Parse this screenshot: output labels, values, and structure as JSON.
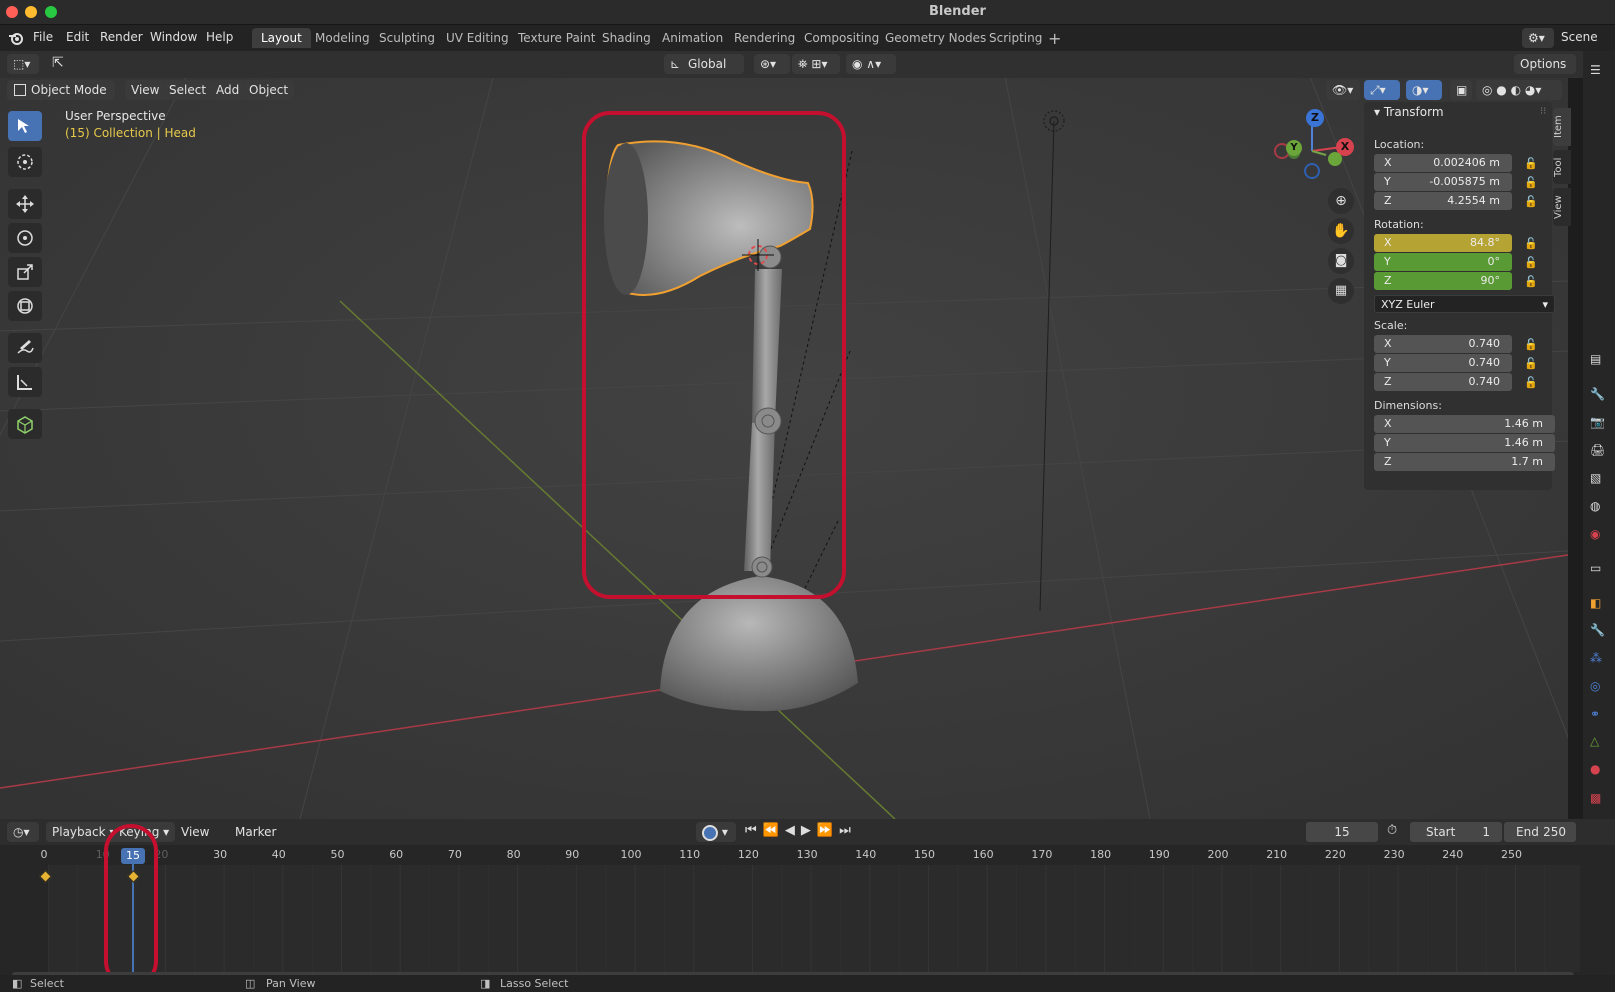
{
  "window": {
    "title": "Blender"
  },
  "menu": [
    "File",
    "Edit",
    "Render",
    "Window",
    "Help"
  ],
  "workspaces": [
    "Layout",
    "Modeling",
    "Sculpting",
    "UV Editing",
    "Texture Paint",
    "Shading",
    "Animation",
    "Rendering",
    "Compositing",
    "Geometry Nodes",
    "Scripting"
  ],
  "active_workspace": "Layout",
  "scene": "Scene",
  "header": {
    "orientation": "Global",
    "options": "Options",
    "mode": "Object Mode",
    "view_menu": [
      "View",
      "Select",
      "Add",
      "Object"
    ]
  },
  "viewport": {
    "perspective": "User Perspective",
    "collection": "(15) Collection | Head"
  },
  "gizmo": {
    "z": "Z",
    "y": "Y",
    "x": "X"
  },
  "npanel": {
    "title": "Transform",
    "location_label": "Location:",
    "location": [
      {
        "axis": "X",
        "value": "0.002406 m"
      },
      {
        "axis": "Y",
        "value": "-0.005875 m"
      },
      {
        "axis": "Z",
        "value": "4.2554 m"
      }
    ],
    "rotation_label": "Rotation:",
    "rotation": [
      {
        "axis": "X",
        "value": "84.8°"
      },
      {
        "axis": "Y",
        "value": "0°"
      },
      {
        "axis": "Z",
        "value": "90°"
      }
    ],
    "rotation_mode": "XYZ Euler",
    "scale_label": "Scale:",
    "scale": [
      {
        "axis": "X",
        "value": "0.740"
      },
      {
        "axis": "Y",
        "value": "0.740"
      },
      {
        "axis": "Z",
        "value": "0.740"
      }
    ],
    "dimensions_label": "Dimensions:",
    "dimensions": [
      {
        "axis": "X",
        "value": "1.46 m"
      },
      {
        "axis": "Y",
        "value": "1.46 m"
      },
      {
        "axis": "Z",
        "value": "1.7 m"
      }
    ],
    "tabs": [
      "Item",
      "Tool",
      "View"
    ]
  },
  "timeline": {
    "menus": [
      "Playback",
      "Keying",
      "View",
      "Marker"
    ],
    "current_frame": "15",
    "start_label": "Start",
    "start": "1",
    "end_label": "End",
    "end": "250",
    "ruler": [
      "0",
      "10",
      "20",
      "30",
      "40",
      "50",
      "60",
      "70",
      "80",
      "90",
      "100",
      "110",
      "120",
      "130",
      "140",
      "150",
      "160",
      "170",
      "180",
      "190",
      "200",
      "210",
      "220",
      "230",
      "240",
      "250"
    ],
    "keyframes": [
      0,
      15
    ]
  },
  "status": {
    "left": "Select",
    "middle": "Pan View",
    "right": "Lasso Select"
  },
  "colors": {
    "accent": "#4772b3",
    "highlight": "#c4102e",
    "rotation_x": "#b5a334",
    "rotation_yz": "#5a9a34",
    "selection": "#f0a030"
  }
}
